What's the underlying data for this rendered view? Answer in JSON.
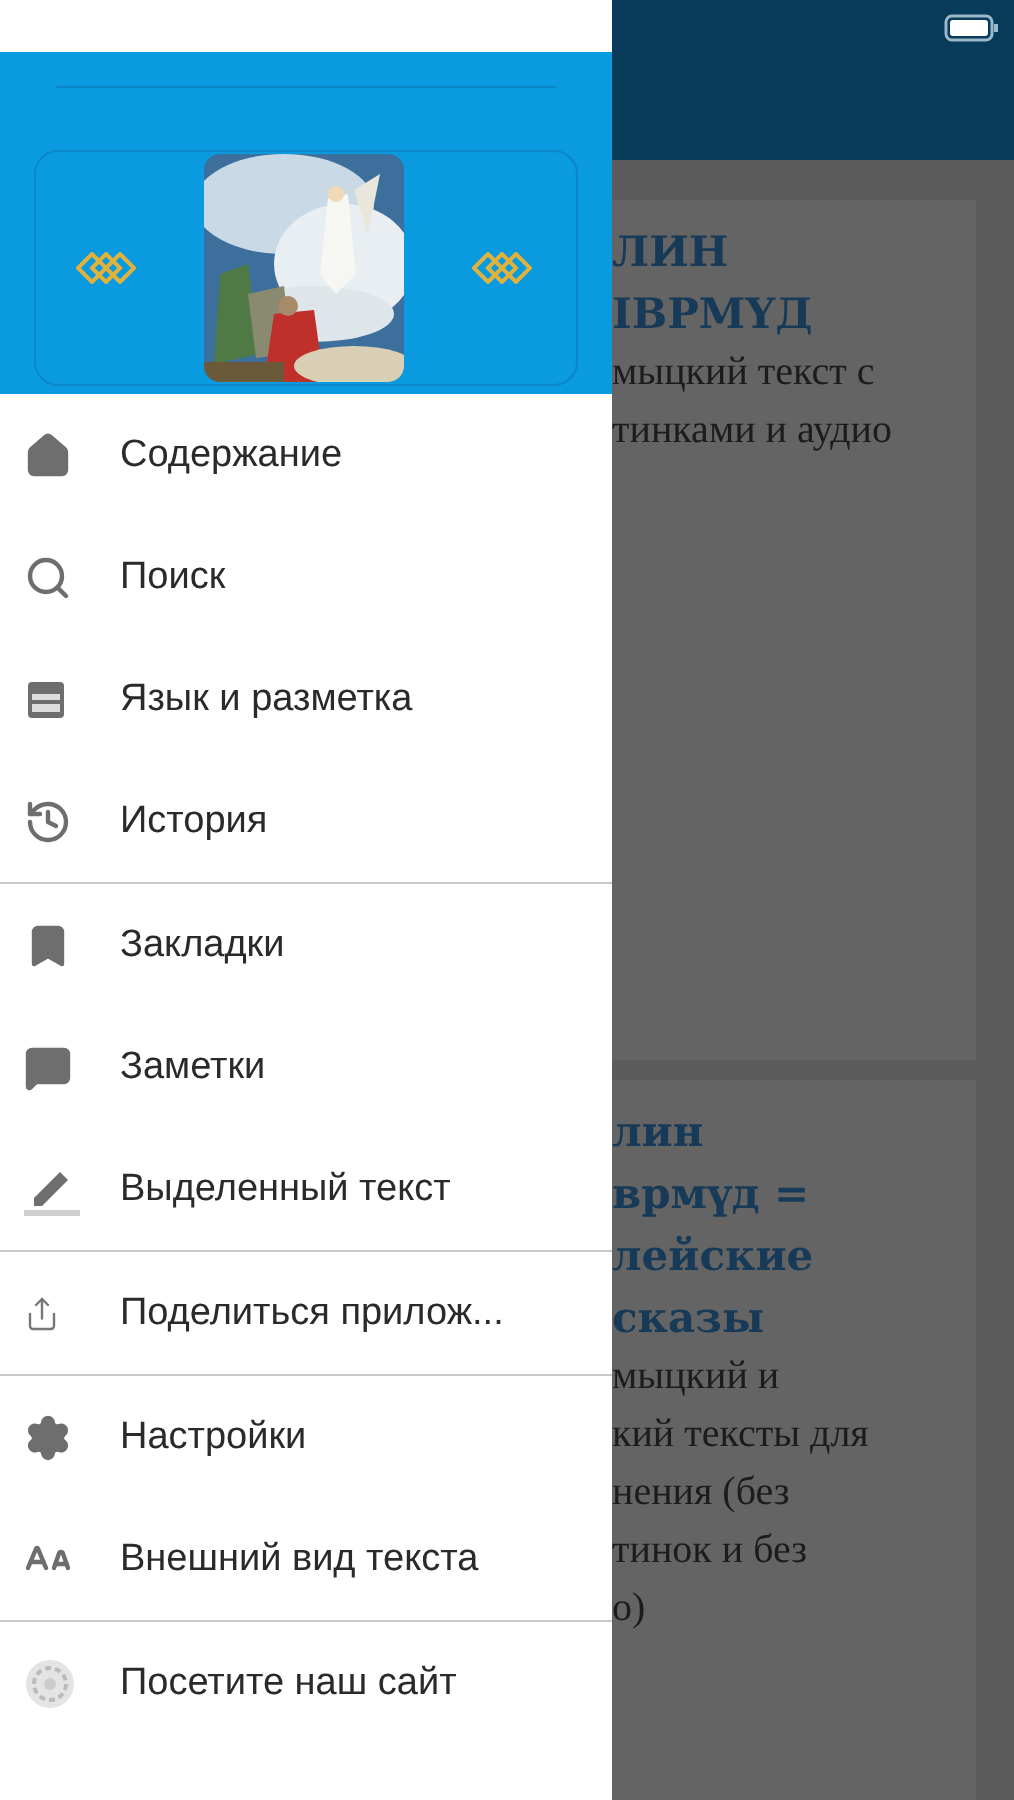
{
  "cards": [
    {
      "title_lines": [
        "ЛИН",
        "ІВРМҮД"
      ],
      "body_lines": [
        "мыцкий текст с",
        "тинками и аудио"
      ]
    },
    {
      "title_lines": [
        "лин",
        "врмүд =",
        "лейские",
        "сказы"
      ],
      "body_lines": [
        "мыцкий и",
        "кий тексты для",
        "нения (без",
        "тинок и без",
        "о)"
      ]
    }
  ],
  "drawer": {
    "header": {
      "image": {
        "kind": "picture"
      }
    },
    "sections": [
      [
        {
          "kind": "home",
          "label": "Содержание"
        },
        {
          "kind": "search",
          "label": "Поиск"
        },
        {
          "kind": "layout",
          "label": "Язык и разметка"
        },
        {
          "kind": "history",
          "label": "История"
        }
      ],
      [
        {
          "kind": "bookmark",
          "label": "Закладки"
        },
        {
          "kind": "notes",
          "label": "Заметки"
        },
        {
          "kind": "highlight",
          "label": "Выделенный текст"
        }
      ],
      [
        {
          "kind": "share",
          "label": "Поделиться прилож..."
        }
      ],
      [
        {
          "kind": "settings",
          "label": "Настройки"
        },
        {
          "kind": "textsize",
          "label": "Внешний вид текста"
        }
      ],
      [
        {
          "kind": "website",
          "label": "Посетите наш сайт"
        }
      ]
    ]
  }
}
